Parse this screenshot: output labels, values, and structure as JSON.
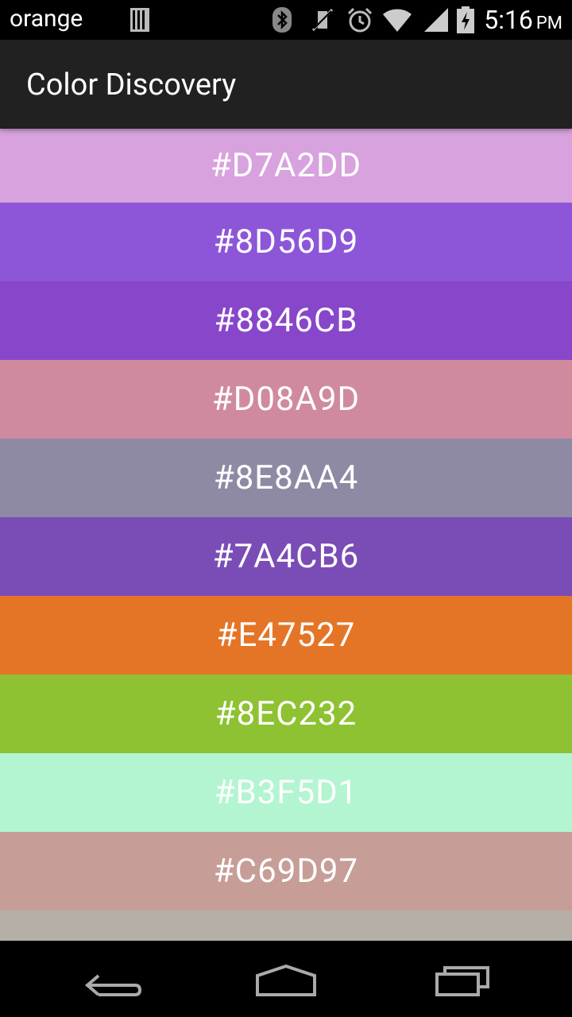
{
  "status_bar": {
    "carrier": "orange",
    "time": "5:16",
    "ampm": "PM",
    "icons": [
      "sim-card-icon",
      "bluetooth-icon",
      "vibrate-mute-icon",
      "alarm-icon",
      "wifi-icon",
      "signal-icon",
      "battery-charging-icon"
    ]
  },
  "app_bar": {
    "title": "Color Discovery"
  },
  "colors": [
    {
      "hex": "#D7A2DD",
      "label": "#D7A2DD"
    },
    {
      "hex": "#8D56D9",
      "label": "#8D56D9"
    },
    {
      "hex": "#8846CB",
      "label": "#8846CB"
    },
    {
      "hex": "#D08A9D",
      "label": "#D08A9D"
    },
    {
      "hex": "#8E8AA4",
      "label": "#8E8AA4"
    },
    {
      "hex": "#7A4CB6",
      "label": "#7A4CB6"
    },
    {
      "hex": "#E47527",
      "label": "#E47527"
    },
    {
      "hex": "#8EC232",
      "label": "#8EC232"
    },
    {
      "hex": "#B3F5D1",
      "label": "#B3F5D1"
    },
    {
      "hex": "#C69D97",
      "label": "#C69D97"
    },
    {
      "hex": "#B5AFA8",
      "label": ""
    }
  ],
  "nav_bar": {
    "icons": [
      "back-icon",
      "home-icon",
      "recents-icon"
    ]
  }
}
